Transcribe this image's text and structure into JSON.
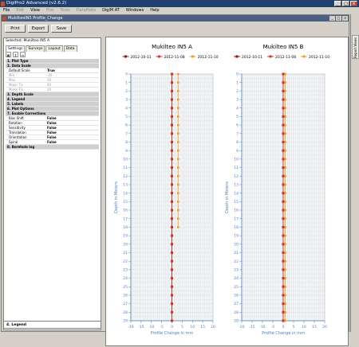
{
  "window": {
    "title": "DigiPro2 Advanced (v2.6.2)"
  },
  "menu": [
    {
      "label": "File",
      "enabled": true
    },
    {
      "label": "Edit",
      "enabled": false
    },
    {
      "label": "View",
      "enabled": true
    },
    {
      "label": "Plot",
      "enabled": false
    },
    {
      "label": "Tools",
      "enabled": false
    },
    {
      "label": "DataMate",
      "enabled": false
    },
    {
      "label": "DigiM AT",
      "enabled": true
    },
    {
      "label": "Windows",
      "enabled": true
    },
    {
      "label": "Help",
      "enabled": true
    }
  ],
  "document": {
    "title": "MukilteoIN5 Profile_Change"
  },
  "toolbar": {
    "print": "Print",
    "export": "Export",
    "save": "Save"
  },
  "panel": {
    "selected": "Selected: Mukilteo IN5 A",
    "tabs": [
      "Settings",
      "Surveys",
      "Layout",
      "Data"
    ],
    "sections": [
      {
        "label": "1. Plot Type",
        "expanded": false
      },
      {
        "label": "2. Data Scale",
        "expanded": true,
        "props": [
          {
            "name": "Default Scale",
            "value": "True",
            "disabled": false
          },
          {
            "name": "Min",
            "value": "-20",
            "disabled": true
          },
          {
            "name": "Max",
            "value": "20",
            "disabled": true
          },
          {
            "name": "Major Tic",
            "value": "40",
            "disabled": true
          },
          {
            "name": "Minor Tic",
            "value": "20",
            "disabled": true
          }
        ]
      },
      {
        "label": "3. Depth Scale",
        "expanded": false
      },
      {
        "label": "4. Legend",
        "expanded": false
      },
      {
        "label": "5. Labels",
        "expanded": false
      },
      {
        "label": "6. Plot Options",
        "expanded": false
      },
      {
        "label": "7. Enable Corrections",
        "expanded": true,
        "props": [
          {
            "name": "Bias Shift",
            "value": "False",
            "disabled": false
          },
          {
            "name": "Rotation",
            "value": "False",
            "disabled": false
          },
          {
            "name": "Sensitivity",
            "value": "False",
            "disabled": false
          },
          {
            "name": "Translation",
            "value": "False",
            "disabled": false
          },
          {
            "name": "Orientation",
            "value": "False",
            "disabled": false
          },
          {
            "name": "Spiral",
            "value": "False",
            "disabled": false
          }
        ]
      },
      {
        "label": "8. Borehole log",
        "expanded": false
      }
    ],
    "help_title": "4. Legend"
  },
  "right_tab": {
    "label": "Report Views"
  },
  "colors": {
    "series1": "#8b1a1a",
    "series2": "#e03020",
    "series3": "#f39a1e"
  },
  "chart_data": [
    {
      "type": "line",
      "title": "Mukilteo IN5 A",
      "xlabel": "Profile Change in mm",
      "ylabel": "Depth in Meters",
      "xlim": [
        -20,
        20
      ],
      "ylim": [
        0,
        29
      ],
      "x_ticks": [
        -20,
        -15,
        -10,
        -5,
        0,
        5,
        10,
        15,
        20
      ],
      "y_ticks": [
        0,
        1,
        2,
        3,
        4,
        5,
        6,
        7,
        8,
        9,
        10,
        11,
        12,
        13,
        14,
        15,
        16,
        17,
        18,
        19,
        20,
        21,
        22,
        23,
        24,
        25,
        26,
        27,
        28,
        29
      ],
      "legend": "top",
      "grid": true,
      "series": [
        {
          "name": "2012-10-11",
          "depth_min": 0,
          "depth_max": 29,
          "values": [
            0,
            0,
            0,
            0,
            0,
            0,
            0,
            0,
            0,
            0,
            0,
            0,
            0,
            0,
            0,
            0,
            0,
            0,
            0,
            0,
            0,
            0,
            0,
            0,
            0,
            0,
            0,
            0,
            0,
            0
          ]
        },
        {
          "name": "2012-11-08",
          "depth_min": 0,
          "depth_max": 29,
          "values": [
            0,
            0,
            0,
            0,
            0,
            0,
            0,
            0,
            0,
            0,
            0,
            0,
            0,
            0,
            0,
            0,
            0,
            0,
            0,
            0,
            0,
            0,
            0,
            0,
            0,
            0,
            0,
            0,
            0,
            0
          ]
        },
        {
          "name": "2012-11-10",
          "depth_min": 0,
          "depth_max": 18,
          "values": [
            3,
            3,
            3,
            3,
            3,
            3,
            3,
            3,
            3,
            3,
            3,
            3,
            3,
            3,
            3,
            3,
            3,
            3,
            3
          ]
        }
      ]
    },
    {
      "type": "line",
      "title": "Mukilteo IN5 B",
      "xlabel": "Profile Change in mm",
      "ylabel": "Depth in Meters",
      "xlim": [
        -20,
        20
      ],
      "ylim": [
        0,
        29
      ],
      "x_ticks": [
        -20,
        -15,
        -10,
        -5,
        0,
        5,
        10,
        15,
        20
      ],
      "y_ticks": [
        0,
        1,
        2,
        3,
        4,
        5,
        6,
        7,
        8,
        9,
        10,
        11,
        12,
        13,
        14,
        15,
        16,
        17,
        18,
        19,
        20,
        21,
        22,
        23,
        24,
        25,
        26,
        27,
        28,
        29
      ],
      "legend": "top",
      "grid": true,
      "series": [
        {
          "name": "2012-10-11",
          "depth_min": 0,
          "depth_max": 29,
          "values": [
            0,
            0,
            0,
            0,
            0,
            0,
            0,
            0,
            0,
            0,
            0,
            0,
            0,
            0,
            0,
            0,
            0,
            0,
            0,
            0,
            0,
            0,
            0,
            0,
            0,
            0,
            0,
            0,
            0,
            0
          ]
        },
        {
          "name": "2012-11-08",
          "depth_min": 0,
          "depth_max": 29,
          "values": [
            0,
            0,
            0,
            0,
            0,
            0,
            0,
            0,
            0,
            0,
            0,
            0,
            0,
            0,
            0,
            0,
            0,
            0,
            0,
            0,
            0,
            0,
            0,
            0,
            0,
            0,
            0,
            0,
            0,
            0
          ]
        },
        {
          "name": "2012-11-10",
          "depth_min": 0,
          "depth_max": 29,
          "values": [
            1,
            1,
            1,
            1,
            1,
            1,
            1,
            1,
            1,
            1,
            1,
            1,
            1,
            1,
            1,
            1,
            1,
            1,
            1,
            1,
            1,
            1,
            1,
            1,
            1,
            1,
            1,
            1,
            1,
            1
          ]
        }
      ]
    }
  ]
}
